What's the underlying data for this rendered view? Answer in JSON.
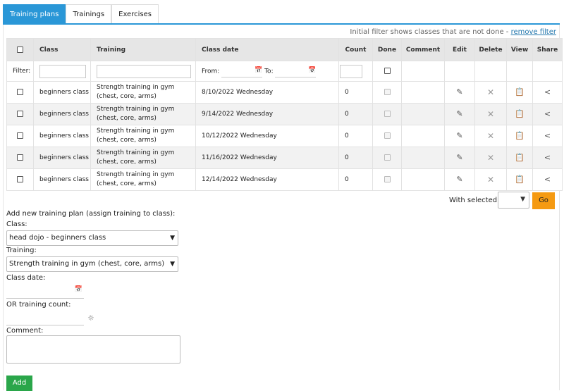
{
  "tabs": [
    {
      "label": "Training plans",
      "active": true
    },
    {
      "label": "Trainings",
      "active": false
    },
    {
      "label": "Exercises",
      "active": false
    }
  ],
  "filter_note": {
    "text": "Initial filter shows classes that are not done - ",
    "link": "remove filter"
  },
  "table": {
    "headers": {
      "class": "Class",
      "training": "Training",
      "class_date": "Class date",
      "count": "Count",
      "done": "Done",
      "comment": "Comment",
      "edit": "Edit",
      "delete": "Delete",
      "view": "View",
      "share": "Share"
    },
    "filter": {
      "label": "Filter:",
      "from": "From:",
      "to": "To:"
    },
    "rows": [
      {
        "class": "beginners class",
        "training": "Strength training in gym (chest, core, arms)",
        "date": "8/10/2022 Wednesday",
        "count": "0"
      },
      {
        "class": "beginners class",
        "training": "Strength training in gym (chest, core, arms)",
        "date": "9/14/2022 Wednesday",
        "count": "0"
      },
      {
        "class": "beginners class",
        "training": "Strength training in gym (chest, core, arms)",
        "date": "10/12/2022 Wednesday",
        "count": "0"
      },
      {
        "class": "beginners class",
        "training": "Strength training in gym (chest, core, arms)",
        "date": "11/16/2022 Wednesday",
        "count": "0"
      },
      {
        "class": "beginners class",
        "training": "Strength training in gym (chest, core, arms)",
        "date": "12/14/2022 Wednesday",
        "count": "0"
      }
    ]
  },
  "bulk": {
    "label": "With selected:",
    "go": "Go"
  },
  "form": {
    "heading": "Add new training plan (assign training to class):",
    "class_label": "Class:",
    "class_value": "head dojo - beginners class",
    "training_label": "Training:",
    "training_value": "Strength training in gym (chest, core, arms)",
    "date_label": "Class date:",
    "count_label": "OR training count:",
    "comment_label": "Comment:",
    "add": "Add"
  },
  "colors": {
    "accent": "#2a97d7",
    "go": "#f59a12",
    "add": "#2aa64a"
  },
  "icons": {
    "edit": "pencil-icon",
    "delete": "close-icon",
    "view": "clipboard-icon",
    "share": "share-icon",
    "calendar": "calendar-icon",
    "hint": "lightbulb-icon"
  }
}
